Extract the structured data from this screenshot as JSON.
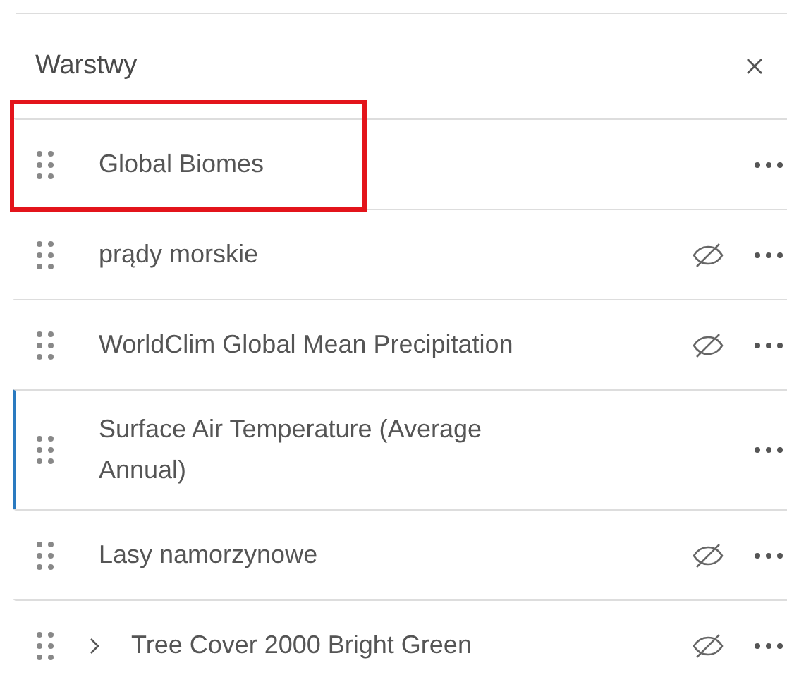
{
  "panel": {
    "title": "Warstwy"
  },
  "layers": [
    {
      "name": "Global Biomes",
      "hidden": false,
      "expandable": false,
      "selected": false,
      "highlighted": true
    },
    {
      "name": "prądy morskie",
      "hidden": true,
      "expandable": false,
      "selected": false,
      "highlighted": false
    },
    {
      "name": "WorldClim Global Mean Precipitation",
      "hidden": true,
      "expandable": false,
      "selected": false,
      "highlighted": false
    },
    {
      "name": "Surface Air Temperature (Average Annual)",
      "hidden": false,
      "expandable": false,
      "selected": true,
      "highlighted": false
    },
    {
      "name": "Lasy namorzynowe",
      "hidden": true,
      "expandable": false,
      "selected": false,
      "highlighted": false
    },
    {
      "name": "Tree Cover 2000 Bright Green",
      "hidden": true,
      "expandable": true,
      "selected": false,
      "highlighted": false
    }
  ]
}
